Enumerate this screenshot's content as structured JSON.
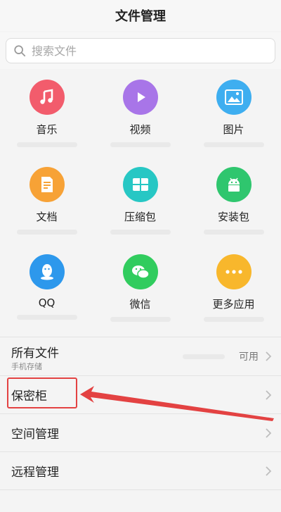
{
  "header": {
    "title": "文件管理"
  },
  "search": {
    "placeholder": "搜索文件"
  },
  "categories": [
    {
      "label": "音乐",
      "icon": "music-note-icon",
      "color": "#F25C6C"
    },
    {
      "label": "视频",
      "icon": "play-icon",
      "color": "#A875E8"
    },
    {
      "label": "图片",
      "icon": "image-icon",
      "color": "#3EAEF0"
    },
    {
      "label": "文档",
      "icon": "document-icon",
      "color": "#F7A236"
    },
    {
      "label": "压缩包",
      "icon": "archive-icon",
      "color": "#27C7C4"
    },
    {
      "label": "安装包",
      "icon": "android-icon",
      "color": "#2FC66E"
    },
    {
      "label": "QQ",
      "icon": "qq-icon",
      "color": "#2D98EC"
    },
    {
      "label": "微信",
      "icon": "wechat-icon",
      "color": "#31CC5E"
    },
    {
      "label": "更多应用",
      "icon": "more-icon",
      "color": "#F8B72C"
    }
  ],
  "list": {
    "all_files": {
      "title": "所有文件",
      "subtitle": "手机存储",
      "value": "可用"
    },
    "safe": {
      "title": "保密柜"
    },
    "space": {
      "title": "空间管理"
    },
    "remote": {
      "title": "远程管理"
    }
  },
  "colors": {
    "annotation": "#E34242"
  }
}
